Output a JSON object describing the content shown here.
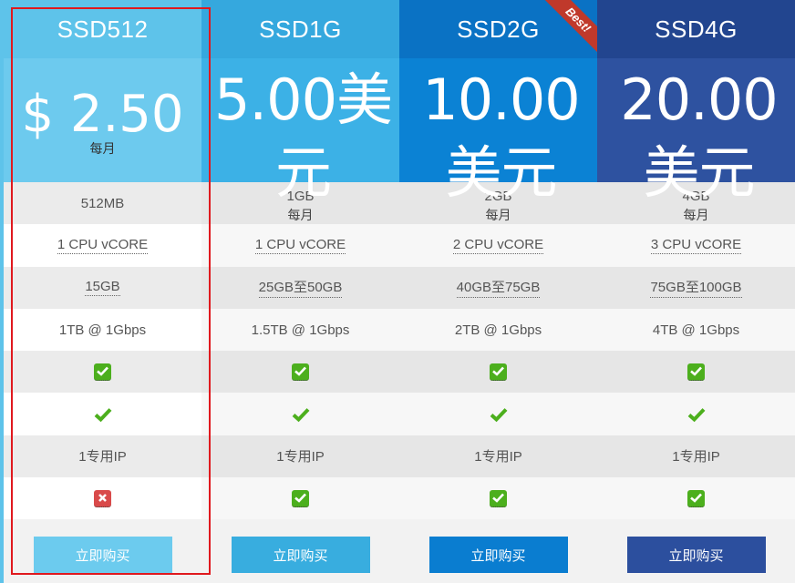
{
  "plans": [
    {
      "name": "SSD512",
      "price": "$ 2.50",
      "period": "每月",
      "ram": "512MB",
      "cpu": "1 CPU vCORE",
      "disk": "15GB",
      "bandwidth": "1TB @ 1Gbps",
      "ip": "1专用IP",
      "buy_label": "立即购买",
      "colors": {
        "header": "#5ec3ea",
        "price_bg": "#6dcaee",
        "button": "#6ccbee"
      }
    },
    {
      "name": "SSD1G",
      "price": "5.00美元",
      "period": "每月",
      "ram": "1GB",
      "cpu": "1 CPU vCORE",
      "disk": "25GB至50GB",
      "bandwidth": "1.5TB @ 1Gbps",
      "ip": "1专用IP",
      "buy_label": "立即购买",
      "colors": {
        "header": "#35a8de",
        "price_bg": "#3cb1e6",
        "button": "#38addf"
      }
    },
    {
      "name": "SSD2G",
      "price": "10.00美元",
      "period": "每月",
      "ram": "2GB",
      "cpu": "2 CPU vCORE",
      "disk": "40GB至75GB",
      "bandwidth": "2TB @ 1Gbps",
      "ip": "1专用IP",
      "buy_label": "立即购买",
      "ribbon": "Best!",
      "colors": {
        "header": "#0a72c4",
        "price_bg": "#0b82d4",
        "button": "#0a7dd0"
      }
    },
    {
      "name": "SSD4G",
      "price": "20.00美元",
      "period": "每月",
      "ram": "4GB",
      "cpu": "3 CPU vCORE",
      "disk": "75GB至100GB",
      "bandwidth": "4TB @ 1Gbps",
      "ip": "1专用IP",
      "buy_label": "立即购买",
      "colors": {
        "header": "#22458f",
        "price_bg": "#2e52a0",
        "button": "#2c4f9e"
      }
    }
  ],
  "features": {
    "feature5_icon": "check-square-icon",
    "feature6_icon": "check-icon",
    "feature8_icons": [
      "cross-square-icon",
      "check-square-icon",
      "check-square-icon",
      "check-square-icon"
    ]
  },
  "highlight_color": "#e0191e"
}
